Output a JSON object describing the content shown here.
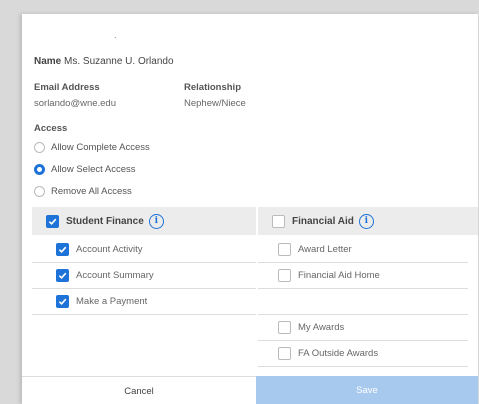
{
  "header": {
    "mark": "."
  },
  "person": {
    "name_label": "Name",
    "name_value": "Ms. Suzanne U. Orlando"
  },
  "email": {
    "label": "Email Address",
    "value": "sorlando@wne.edu"
  },
  "relationship": {
    "label": "Relationship",
    "value": "Nephew/Niece"
  },
  "access": {
    "label": "Access",
    "options": [
      {
        "label": "Allow Complete Access",
        "selected": false
      },
      {
        "label": "Allow Select Access",
        "selected": true
      },
      {
        "label": "Remove All Access",
        "selected": false
      }
    ]
  },
  "student_finance": {
    "title": "Student Finance",
    "checked": true,
    "items": [
      {
        "label": "Account Activity",
        "checked": true
      },
      {
        "label": "Account Summary",
        "checked": true
      },
      {
        "label": "Make a Payment",
        "checked": true
      }
    ]
  },
  "financial_aid": {
    "title": "Financial Aid",
    "checked": false,
    "items": [
      {
        "label": "Award Letter",
        "checked": false
      },
      {
        "label": "Financial Aid Home",
        "checked": false
      },
      {
        "label": "",
        "checked": false
      },
      {
        "label": "My Awards",
        "checked": false
      },
      {
        "label": "FA Outside Awards",
        "checked": false
      }
    ]
  },
  "info_glyph": "i",
  "footer": {
    "cancel_label": "Cancel",
    "save_label": "Save"
  },
  "colors": {
    "accent": "#1e73d8",
    "save_disabled": "#a8c9ee",
    "header_bg": "#ececec"
  }
}
